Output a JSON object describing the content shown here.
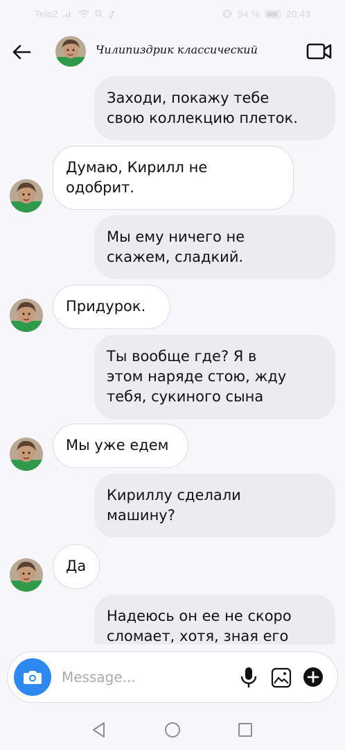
{
  "status_bar": {
    "carrier": "Tele2",
    "battery": "94 %",
    "time": "20:43"
  },
  "header": {
    "title": "Чилипиздрик классический",
    "back_icon": "back-arrow-icon",
    "video_icon": "video-camera-icon"
  },
  "messages": [
    {
      "direction": "out",
      "text": "Заходи, покажу тебе\nсвою коллекцию плеток."
    },
    {
      "direction": "in",
      "text": "Думаю, Кирилл не\nодобрит."
    },
    {
      "direction": "out",
      "text": "Мы ему ничего не\nскажем, сладкий."
    },
    {
      "direction": "in",
      "text": "Придурок."
    },
    {
      "direction": "out",
      "text": "Ты вообще где? Я в\nэтом наряде стою, жду\nтебя, сукиного сына"
    },
    {
      "direction": "in",
      "text": "Мы уже едем"
    },
    {
      "direction": "out",
      "text": "Кириллу сделали\nмашину?"
    },
    {
      "direction": "in",
      "text": "Да"
    },
    {
      "direction": "out",
      "text": "Надеюсь он ее не скоро\nсломает, хотя, зная его"
    }
  ],
  "composer": {
    "placeholder": "Message...",
    "camera_icon": "camera-icon",
    "mic_icon": "microphone-icon",
    "gallery_icon": "gallery-icon",
    "add_icon": "plus-icon",
    "accent_color": "#2d88f0"
  },
  "colors": {
    "background": "#f7f6fa",
    "outgoing_bubble": "#ececf0",
    "incoming_bubble": "#ffffff"
  }
}
